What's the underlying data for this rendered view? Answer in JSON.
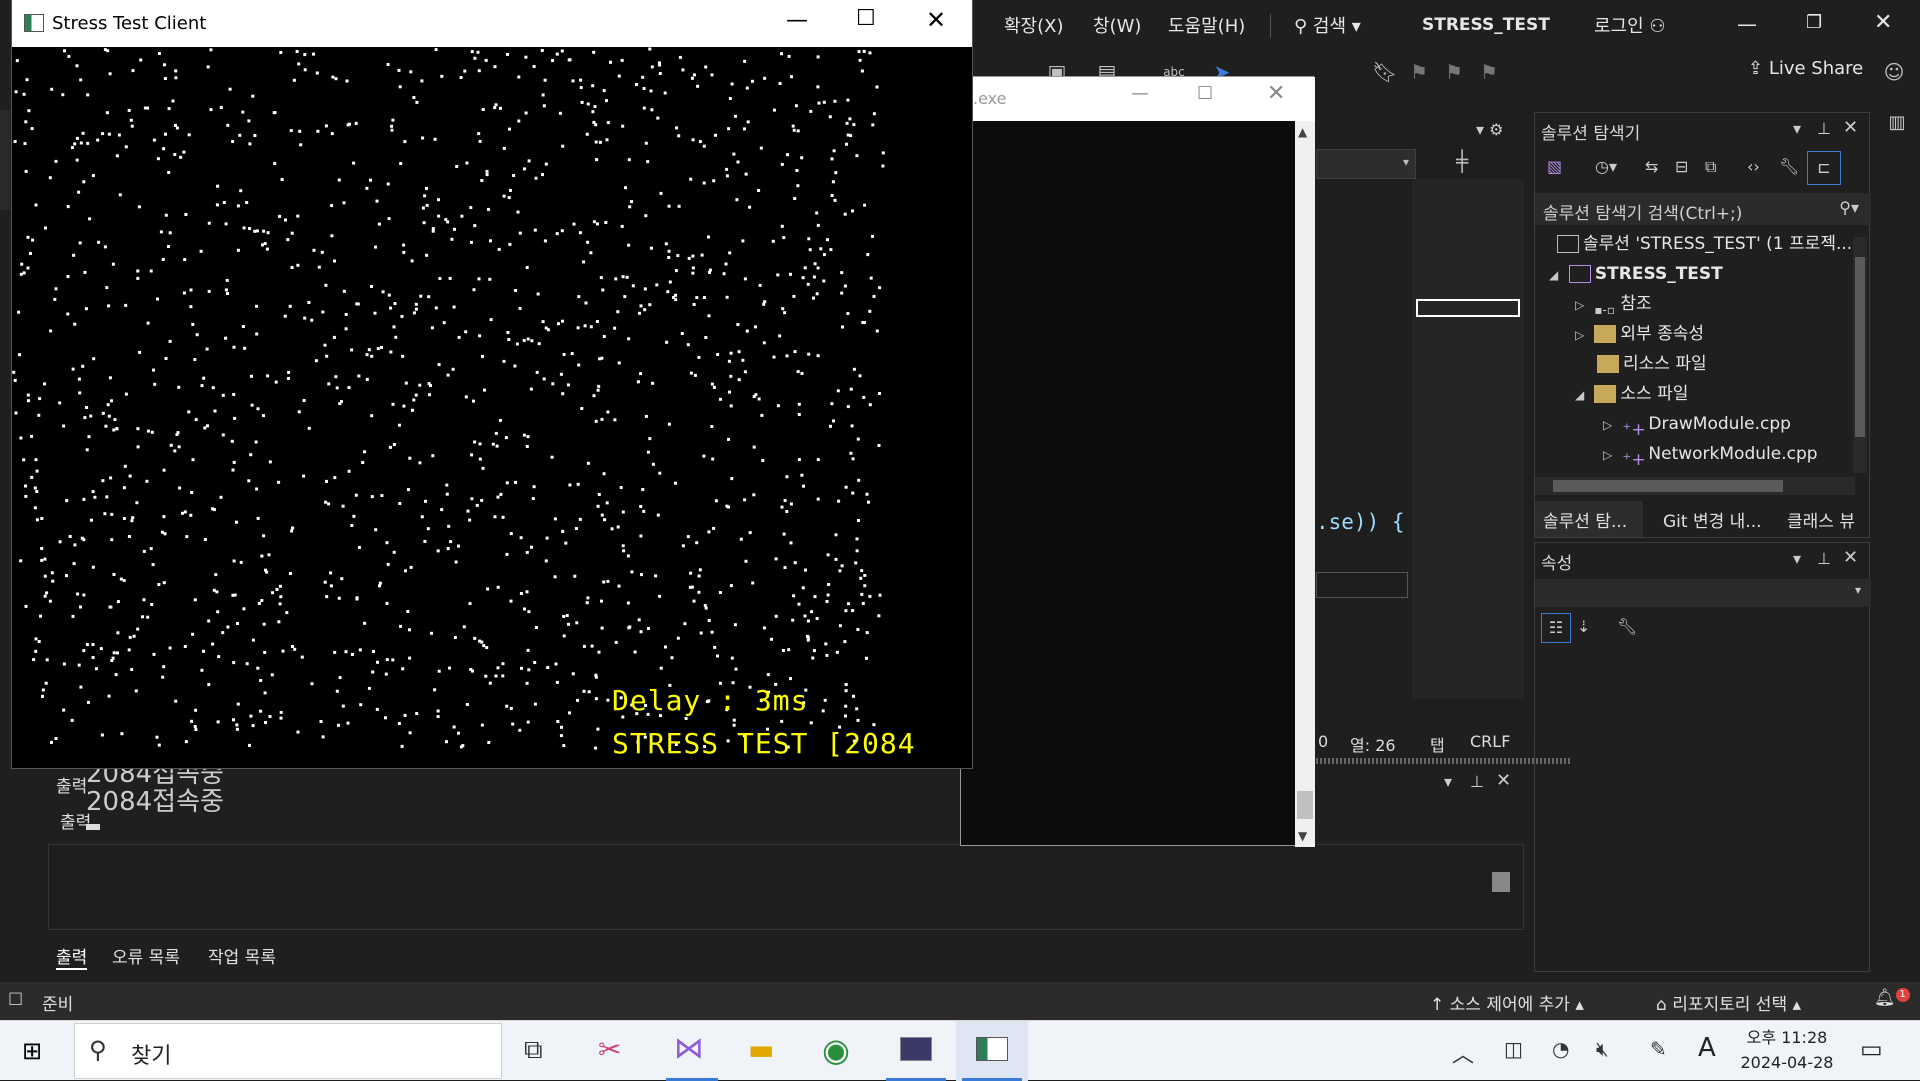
{
  "vs": {
    "menu": {
      "extensions": "확장(X)",
      "window": "창(W)",
      "help": "도움말(H)",
      "search": "검색",
      "solution_name": "STRESS_TEST",
      "login": "로그인"
    },
    "live_share": "Live Share",
    "editor_code_fragment": ".se)) {",
    "status": {
      "ready": "준비",
      "col": "열: 26",
      "tab": "탭",
      "crlf": "CRLF",
      "add_source_control": "소스 제어에 추가",
      "select_repo": "리포지토리 선택"
    },
    "line_col_prefix": "0"
  },
  "solution_explorer": {
    "title": "솔루션 탐색기",
    "search_placeholder": "솔루션 탐색기 검색(Ctrl+;)",
    "tree": [
      {
        "label": "솔루션 'STRESS_TEST' (1 프로젝...",
        "level": 0,
        "expanded": null,
        "icon": "solution-icon"
      },
      {
        "label": "STRESS_TEST",
        "level": 1,
        "expanded": true,
        "icon": "project-icon"
      },
      {
        "label": "참조",
        "level": 2,
        "expanded": false,
        "icon": "references-icon"
      },
      {
        "label": "외부 종속성",
        "level": 2,
        "expanded": false,
        "icon": "folder-icon"
      },
      {
        "label": "리소스 파일",
        "level": 2,
        "expanded": null,
        "icon": "filter-folder-icon"
      },
      {
        "label": "소스 파일",
        "level": 2,
        "expanded": true,
        "icon": "filter-folder-icon"
      },
      {
        "label": "DrawModule.cpp",
        "level": 3,
        "expanded": false,
        "icon": "cpp-file-icon"
      },
      {
        "label": "NetworkModule.cpp",
        "level": 3,
        "expanded": false,
        "icon": "cpp-file-icon"
      }
    ],
    "tabs": [
      "솔루션 탐...",
      "Git 변경 내...",
      "클래스 뷰"
    ]
  },
  "properties": {
    "title": "속성"
  },
  "output_panel": {
    "title_partial": "출력",
    "title_partial2": "출력",
    "tabs": [
      "출력",
      "오류 목록",
      "작업 목록"
    ]
  },
  "client": {
    "title": "Stress Test Client",
    "delay": "Delay : 3ms",
    "stress": "STRESS TEST [2084"
  },
  "console": {
    "title_partial": ".exe",
    "lines": [
      "2084접속중",
      "2084접속중"
    ]
  },
  "taskbar": {
    "search": "찾기",
    "time": "오후 11:28",
    "date": "2024-04-28",
    "ime": "A"
  },
  "colors": {
    "accent": "#3a7bd5",
    "client_text": "#ffff00",
    "vs_bg": "#1f1f1f"
  }
}
